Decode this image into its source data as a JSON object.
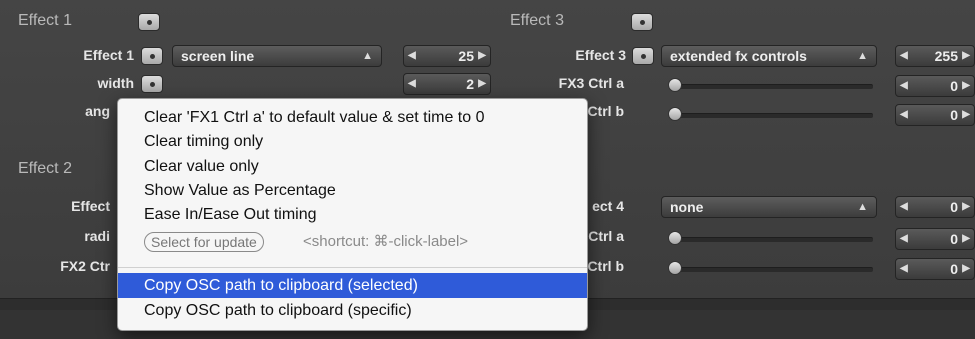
{
  "effect1": {
    "title": "Effect 1",
    "rows": [
      {
        "label": "Effect 1",
        "select": "screen line",
        "value": "25"
      },
      {
        "label": "width",
        "value": "2"
      },
      {
        "label": "ang"
      }
    ]
  },
  "effect2": {
    "title": "Effect 2",
    "rows": [
      {
        "label": "Effect"
      },
      {
        "label": "radi"
      },
      {
        "label": "FX2 Ctr"
      }
    ]
  },
  "effect3": {
    "title": "Effect 3",
    "rows": [
      {
        "label": "Effect 3",
        "select": "extended fx controls",
        "value": "255"
      },
      {
        "label": "FX3 Ctrl a",
        "value": "0"
      },
      {
        "label": "Ctrl b",
        "value": "0"
      }
    ]
  },
  "effect4": {
    "rows": [
      {
        "label": "ect 4",
        "select": "none",
        "value": "0"
      },
      {
        "label": "Ctrl a",
        "value": "0"
      },
      {
        "label": "Ctrl b",
        "value": "0"
      }
    ]
  },
  "menu": {
    "items": [
      "Clear 'FX1 Ctrl a' to default value & set time to 0",
      "Clear timing only",
      "Clear value only",
      "Show Value as Percentage",
      "Ease In/Ease Out timing"
    ],
    "select_for_update": "Select for update",
    "shortcut": "<shortcut: ⌘-click-label>",
    "copy_selected": "Copy OSC path to clipboard (selected)",
    "copy_specific": "Copy OSC path to clipboard (specific)"
  }
}
